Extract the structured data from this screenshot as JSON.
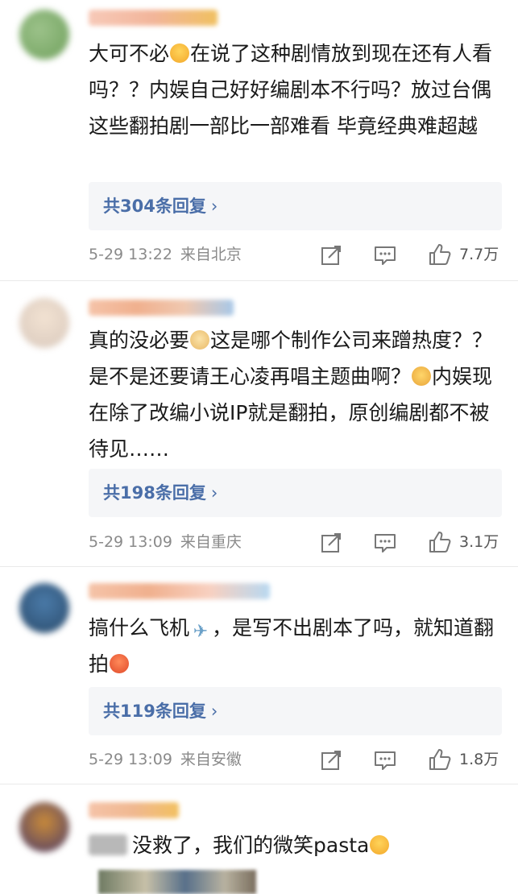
{
  "comments": [
    {
      "text_before": "大可不必",
      "emoji1": "crying-face",
      "text_after": "在说了这种剧情放到现在还有人看吗？？内娱自己好好编剧本不行吗？放过台偶 这些翻拍剧一部比一部难看 毕竟经典难超越",
      "replies_label": "共304条回复",
      "time": "5-29 13:22",
      "location": "来自北京",
      "likes": "7.7万"
    },
    {
      "text_part1": "真的没必要",
      "emoji1": "doge-face",
      "text_part2": "这是哪个制作公司来蹭热度？？是不是还要请王心凌再唱主题曲啊？",
      "emoji2": "cat-face",
      "text_part3": "内娱现在除了改编小说IP就是翻拍，原创编剧都不被待见……",
      "replies_label": "共198条回复",
      "time": "5-29 13:09",
      "location": "来自重庆",
      "likes": "3.1万"
    },
    {
      "text_part1": "搞什么飞机",
      "emoji1": "airplane",
      "text_part2": "，是写不出剧本了吗，就知道翻拍",
      "emoji2": "angry-face",
      "replies_label": "共119条回复",
      "time": "5-29 13:09",
      "location": "来自安徽",
      "likes": "1.8万"
    },
    {
      "text": "没救了，我们的微笑pasta",
      "emoji1": "crying-face"
    }
  ],
  "colors": {
    "link_blue": "#4a6ea8",
    "meta_gray": "#8a8a8a",
    "reply_bg": "#f5f6f8"
  }
}
